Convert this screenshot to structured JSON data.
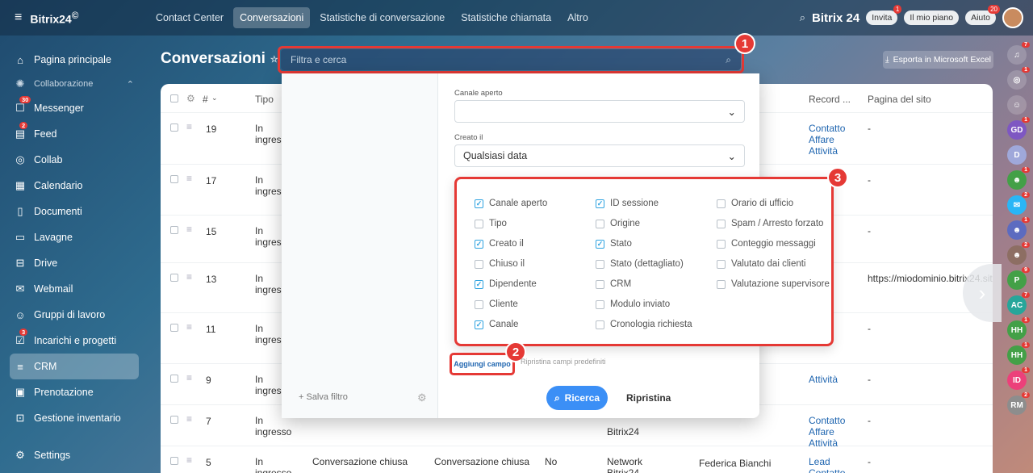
{
  "topbar": {
    "brand": "Bitrix24",
    "brand_suffix": "©",
    "tabs": [
      "Contact Center",
      "Conversazioni",
      "Statistiche di conversazione",
      "Statistiche chiamata",
      "Altro"
    ],
    "right_brand": "Bitrix 24",
    "invite": "Invita",
    "invite_badge": "1",
    "plan": "Il mio piano",
    "help": "Aiuto",
    "help_badge": "20"
  },
  "sidebar": {
    "items": [
      {
        "label": "Pagina principale",
        "icon": "home-icon"
      },
      {
        "label": "Collaborazione",
        "icon": "collab-icon"
      },
      {
        "label": "Messenger",
        "icon": "chat-icon",
        "count": "30"
      },
      {
        "label": "Feed",
        "icon": "feed-icon",
        "count": "2"
      },
      {
        "label": "Collab",
        "icon": "collab-circle-icon"
      },
      {
        "label": "Calendario",
        "icon": "calendar-icon"
      },
      {
        "label": "Documenti",
        "icon": "document-icon"
      },
      {
        "label": "Lavagne",
        "icon": "board-icon"
      },
      {
        "label": "Drive",
        "icon": "drive-icon"
      },
      {
        "label": "Webmail",
        "icon": "mail-icon"
      },
      {
        "label": "Gruppi di lavoro",
        "icon": "group-icon"
      },
      {
        "label": "Incarichi e progetti",
        "icon": "task-icon",
        "count": "3"
      },
      {
        "label": "CRM",
        "icon": "crm-icon"
      },
      {
        "label": "Prenotazione",
        "icon": "booking-icon"
      },
      {
        "label": "Gestione inventario",
        "icon": "inventory-icon"
      },
      {
        "label": "Settings",
        "icon": "settings-icon"
      }
    ]
  },
  "page": {
    "title": "Conversazioni",
    "search_placeholder": "Filtra e cerca",
    "export": "Esporta in Microsoft Excel"
  },
  "grid": {
    "headers": [
      "#",
      "Tipo",
      "Record ...",
      "Pagina del sito"
    ],
    "rows": [
      {
        "id": "19",
        "type": "In ingresso",
        "record": [
          "Contatto",
          "Affare",
          "Attività"
        ],
        "site": "-"
      },
      {
        "id": "17",
        "type": "In ingresso",
        "record": [],
        "site": "-"
      },
      {
        "id": "15",
        "type": "In ingresso",
        "record": [],
        "site": "-"
      },
      {
        "id": "13",
        "type": "In ingresso",
        "record": [],
        "site": "https://miodominio.bitrix24.site/"
      },
      {
        "id": "11",
        "type": "In ingresso",
        "record": [],
        "site": "-"
      },
      {
        "id": "9",
        "type": "In ingresso",
        "record": [
          "Attività"
        ],
        "site": "-"
      },
      {
        "id": "7",
        "type": "In ingresso",
        "col3": "Bitrix24",
        "record": [
          "Contatto",
          "Affare",
          "Attività"
        ],
        "site": "-"
      },
      {
        "id": "5",
        "type": "In ingresso",
        "c1": "Conversazione chiusa",
        "c2": "Conversazione chiusa",
        "c3": "No",
        "c4": "Network Bitrix24",
        "c5": "Federica Bianchi",
        "record": [
          "Lead",
          "Contatto"
        ],
        "site": "-"
      }
    ]
  },
  "filter": {
    "open_channel_label": "Canale aperto",
    "open_channel_value": "",
    "created_label": "Creato il",
    "created_value": "Qualsiasi data",
    "fields": [
      [
        {
          "label": "Canale aperto",
          "on": true
        },
        {
          "label": "Tipo",
          "on": false
        },
        {
          "label": "Creato il",
          "on": true
        },
        {
          "label": "Chiuso il",
          "on": false
        },
        {
          "label": "Dipendente",
          "on": true
        },
        {
          "label": "Cliente",
          "on": false
        },
        {
          "label": "Canale",
          "on": true
        }
      ],
      [
        {
          "label": "ID sessione",
          "on": true
        },
        {
          "label": "Origine",
          "on": false
        },
        {
          "label": "Stato",
          "on": true
        },
        {
          "label": "Stato (dettagliato)",
          "on": false
        },
        {
          "label": "CRM",
          "on": false
        },
        {
          "label": "Modulo inviato",
          "on": false
        },
        {
          "label": "Cronologia richiesta",
          "on": false
        }
      ],
      [
        {
          "label": "Orario di ufficio",
          "on": false
        },
        {
          "label": "Spam / Arresto forzato",
          "on": false
        },
        {
          "label": "Conteggio messaggi",
          "on": false
        },
        {
          "label": "Valutato dai clienti",
          "on": false
        },
        {
          "label": "Valutazione supervisore",
          "on": false
        }
      ]
    ],
    "add_field": "Aggiungi campo",
    "reset_fields": "Ripristina campi predefiniti",
    "search_btn": "Ricerca",
    "reset_btn": "Ripristina",
    "save_filter": "+ Salva filtro"
  },
  "markers": [
    "1",
    "2",
    "3"
  ],
  "rightbar": [
    {
      "text": "",
      "icon": "bell-icon",
      "n": "7"
    },
    {
      "text": "",
      "icon": "pulse-icon",
      "n": "1"
    },
    {
      "text": "",
      "icon": "chat-bubble-icon",
      "n": ""
    },
    {
      "text": "GD",
      "n": "1",
      "color": "#7e57c2"
    },
    {
      "text": "D",
      "n": "",
      "color": "#9fa8da"
    },
    {
      "text": "",
      "icon": "group-avatar-icon",
      "n": "1",
      "color": "#43a047"
    },
    {
      "text": "",
      "icon": "chat-group-icon",
      "n": "2",
      "color": "#29b6f6"
    },
    {
      "text": "",
      "icon": "team-icon",
      "n": "1",
      "color": "#5c6bc0"
    },
    {
      "text": "",
      "icon": "photo-avatar-icon",
      "n": "2",
      "color": "#8d6e63"
    },
    {
      "text": "P",
      "n": "9",
      "color": "#43a047"
    },
    {
      "text": "AC",
      "n": "7",
      "color": "#26a69a"
    },
    {
      "text": "HH",
      "n": "1",
      "color": "#43a047"
    },
    {
      "text": "HH",
      "n": "1",
      "color": "#43a047"
    },
    {
      "text": "ID",
      "n": "1",
      "color": "#ec407a"
    },
    {
      "text": "RM",
      "n": "2",
      "color": "#8d8d8d"
    }
  ]
}
